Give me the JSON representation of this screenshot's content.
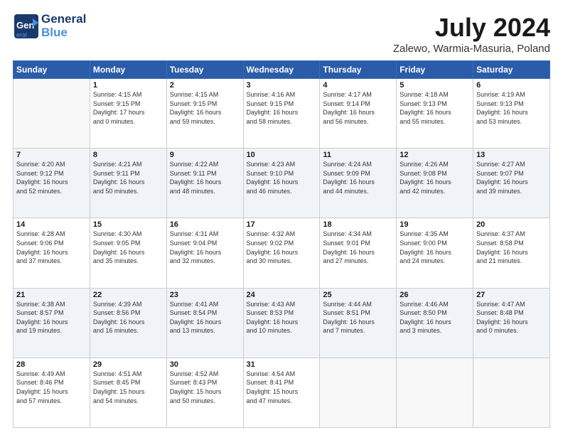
{
  "header": {
    "logo_line1": "General",
    "logo_line2": "Blue",
    "title": "July 2024",
    "subtitle": "Zalewo, Warmia-Masuria, Poland"
  },
  "days_of_week": [
    "Sunday",
    "Monday",
    "Tuesday",
    "Wednesday",
    "Thursday",
    "Friday",
    "Saturday"
  ],
  "weeks": [
    {
      "shaded": false,
      "days": [
        {
          "number": "",
          "info": ""
        },
        {
          "number": "1",
          "info": "Sunrise: 4:15 AM\nSunset: 9:15 PM\nDaylight: 17 hours\nand 0 minutes."
        },
        {
          "number": "2",
          "info": "Sunrise: 4:15 AM\nSunset: 9:15 PM\nDaylight: 16 hours\nand 59 minutes."
        },
        {
          "number": "3",
          "info": "Sunrise: 4:16 AM\nSunset: 9:15 PM\nDaylight: 16 hours\nand 58 minutes."
        },
        {
          "number": "4",
          "info": "Sunrise: 4:17 AM\nSunset: 9:14 PM\nDaylight: 16 hours\nand 56 minutes."
        },
        {
          "number": "5",
          "info": "Sunrise: 4:18 AM\nSunset: 9:13 PM\nDaylight: 16 hours\nand 55 minutes."
        },
        {
          "number": "6",
          "info": "Sunrise: 4:19 AM\nSunset: 9:13 PM\nDaylight: 16 hours\nand 53 minutes."
        }
      ]
    },
    {
      "shaded": true,
      "days": [
        {
          "number": "7",
          "info": "Sunrise: 4:20 AM\nSunset: 9:12 PM\nDaylight: 16 hours\nand 52 minutes."
        },
        {
          "number": "8",
          "info": "Sunrise: 4:21 AM\nSunset: 9:11 PM\nDaylight: 16 hours\nand 50 minutes."
        },
        {
          "number": "9",
          "info": "Sunrise: 4:22 AM\nSunset: 9:11 PM\nDaylight: 16 hours\nand 48 minutes."
        },
        {
          "number": "10",
          "info": "Sunrise: 4:23 AM\nSunset: 9:10 PM\nDaylight: 16 hours\nand 46 minutes."
        },
        {
          "number": "11",
          "info": "Sunrise: 4:24 AM\nSunset: 9:09 PM\nDaylight: 16 hours\nand 44 minutes."
        },
        {
          "number": "12",
          "info": "Sunrise: 4:26 AM\nSunset: 9:08 PM\nDaylight: 16 hours\nand 42 minutes."
        },
        {
          "number": "13",
          "info": "Sunrise: 4:27 AM\nSunset: 9:07 PM\nDaylight: 16 hours\nand 39 minutes."
        }
      ]
    },
    {
      "shaded": false,
      "days": [
        {
          "number": "14",
          "info": "Sunrise: 4:28 AM\nSunset: 9:06 PM\nDaylight: 16 hours\nand 37 minutes."
        },
        {
          "number": "15",
          "info": "Sunrise: 4:30 AM\nSunset: 9:05 PM\nDaylight: 16 hours\nand 35 minutes."
        },
        {
          "number": "16",
          "info": "Sunrise: 4:31 AM\nSunset: 9:04 PM\nDaylight: 16 hours\nand 32 minutes."
        },
        {
          "number": "17",
          "info": "Sunrise: 4:32 AM\nSunset: 9:02 PM\nDaylight: 16 hours\nand 30 minutes."
        },
        {
          "number": "18",
          "info": "Sunrise: 4:34 AM\nSunset: 9:01 PM\nDaylight: 16 hours\nand 27 minutes."
        },
        {
          "number": "19",
          "info": "Sunrise: 4:35 AM\nSunset: 9:00 PM\nDaylight: 16 hours\nand 24 minutes."
        },
        {
          "number": "20",
          "info": "Sunrise: 4:37 AM\nSunset: 8:58 PM\nDaylight: 16 hours\nand 21 minutes."
        }
      ]
    },
    {
      "shaded": true,
      "days": [
        {
          "number": "21",
          "info": "Sunrise: 4:38 AM\nSunset: 8:57 PM\nDaylight: 16 hours\nand 19 minutes."
        },
        {
          "number": "22",
          "info": "Sunrise: 4:39 AM\nSunset: 8:56 PM\nDaylight: 16 hours\nand 16 minutes."
        },
        {
          "number": "23",
          "info": "Sunrise: 4:41 AM\nSunset: 8:54 PM\nDaylight: 16 hours\nand 13 minutes."
        },
        {
          "number": "24",
          "info": "Sunrise: 4:43 AM\nSunset: 8:53 PM\nDaylight: 16 hours\nand 10 minutes."
        },
        {
          "number": "25",
          "info": "Sunrise: 4:44 AM\nSunset: 8:51 PM\nDaylight: 16 hours\nand 7 minutes."
        },
        {
          "number": "26",
          "info": "Sunrise: 4:46 AM\nSunset: 8:50 PM\nDaylight: 16 hours\nand 3 minutes."
        },
        {
          "number": "27",
          "info": "Sunrise: 4:47 AM\nSunset: 8:48 PM\nDaylight: 16 hours\nand 0 minutes."
        }
      ]
    },
    {
      "shaded": false,
      "days": [
        {
          "number": "28",
          "info": "Sunrise: 4:49 AM\nSunset: 8:46 PM\nDaylight: 15 hours\nand 57 minutes."
        },
        {
          "number": "29",
          "info": "Sunrise: 4:51 AM\nSunset: 8:45 PM\nDaylight: 15 hours\nand 54 minutes."
        },
        {
          "number": "30",
          "info": "Sunrise: 4:52 AM\nSunset: 8:43 PM\nDaylight: 15 hours\nand 50 minutes."
        },
        {
          "number": "31",
          "info": "Sunrise: 4:54 AM\nSunset: 8:41 PM\nDaylight: 15 hours\nand 47 minutes."
        },
        {
          "number": "",
          "info": ""
        },
        {
          "number": "",
          "info": ""
        },
        {
          "number": "",
          "info": ""
        }
      ]
    }
  ]
}
